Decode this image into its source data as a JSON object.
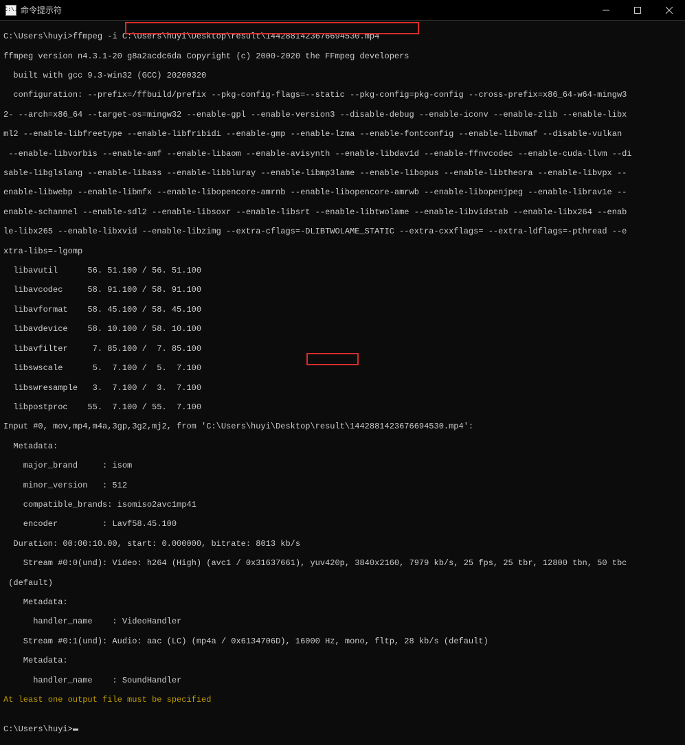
{
  "titlebar": {
    "icon_text": "C:\\.",
    "title": "命令提示符"
  },
  "prompt1": "C:\\Users\\huyi>",
  "cmd": "ffmpeg -i ",
  "file_arg": "C:\\Users\\huyi\\Desktop\\result\\1442881423676694530.mp4",
  "line2_a": "ffmpeg version n4.3.1-20",
  "line2_b": " g8a2acdc6da Copyright (c) 2000-2020 the FFmpeg developers",
  "line3": "  built with gcc 9.3-win32 (GCC) 20200320",
  "cfg1": "  configuration: --prefix=/ffbuild/prefix --pkg-config-flags=--static --pkg-config=pkg-config --cross-prefix=x86_64-w64-mingw3",
  "cfg2": "2- --arch=x86_64 --target-os=mingw32 --enable-gpl --enable-version3 --disable-debug --enable-iconv --enable-zlib --enable-libx",
  "cfg3": "ml2 --enable-libfreetype --enable-libfribidi --enable-gmp --enable-lzma --enable-fontconfig --enable-libvmaf --disable-vulkan",
  "cfg4": " --enable-libvorbis --enable-amf --enable-libaom --enable-avisynth --enable-libdav1d --enable-ffnvcodec --enable-cuda-llvm --di",
  "cfg5": "sable-libglslang --enable-libass --enable-libbluray --enable-libmp3lame --enable-libopus --enable-libtheora --enable-libvpx --",
  "cfg6": "enable-libwebp --enable-libmfx --enable-libopencore-amrnb --enable-libopencore-amrwb --enable-libopenjpeg --enable-librav1e --",
  "cfg7": "enable-schannel --enable-sdl2 --enable-libsoxr --enable-libsrt --enable-libtwolame --enable-libvidstab --enable-libx264 --enab",
  "cfg8": "le-libx265 --enable-libxvid --enable-libzimg --extra-cflags=-DLIBTWOLAME_STATIC --extra-cxxflags= --extra-ldflags=-pthread --e",
  "cfg9": "xtra-libs=-lgomp",
  "lib1": "  libavutil      56. 51.100 / 56. 51.100",
  "lib2": "  libavcodec     58. 91.100 / 58. 91.100",
  "lib3": "  libavformat    58. 45.100 / 58. 45.100",
  "lib4": "  libavdevice    58. 10.100 / 58. 10.100",
  "lib5": "  libavfilter     7. 85.100 /  7. 85.100",
  "lib6": "  libswscale      5.  7.100 /  5.  7.100",
  "lib7": "  libswresample   3.  7.100 /  3.  7.100",
  "lib8": "  libpostproc    55.  7.100 / 55.  7.100",
  "inp": "Input #0, mov,mp4,m4a,3gp,3g2,mj2, from 'C:\\Users\\huyi\\Desktop\\result\\1442881423676694530.mp4':",
  "m1": "  Metadata:",
  "m2": "    major_brand     : isom",
  "m3": "    minor_version   : 512",
  "m4": "    compatible_brands: isomiso2avc1mp41",
  "m5": "    encoder         : Lavf58.45.100",
  "dur": "  Duration: 00:00:10.00, start: 0.000000, bitrate: 8013 kb/s",
  "s0": "    Stream #0:0(und): Video: h264 (High) (avc1 / 0x31637661), yuv420p, 3840x2160, 7979 kb/s, 25 fps, 25 tbr, 12800 tbn, 50 tbc",
  "s0b": " (default)",
  "md1": "    Metadata:",
  "hn1": "      handler_name    : VideoHandler",
  "s1a": "    Stream #0:1(und): Audio: aac (LC) (mp4a / 0x6134706D),",
  "s1b": " 16000 Hz,",
  "s1c": " mono, fltp, 28 kb/s (default)",
  "md2": "    Metadata:",
  "hn2": "      handler_name    : SoundHandler",
  "err": "At least one output file must be specified",
  "blank": "",
  "prompt2": "C:\\Users\\huyi>"
}
